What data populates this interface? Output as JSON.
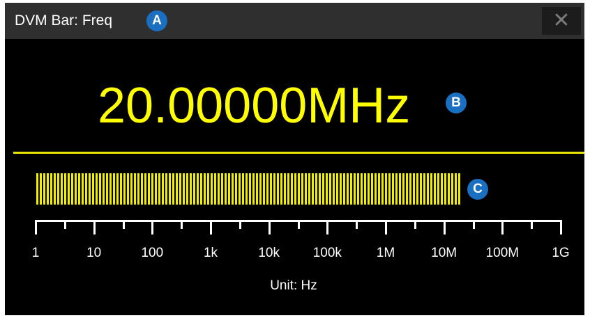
{
  "window": {
    "title": "DVM Bar: Freq",
    "close_symbol": "✕",
    "close_icon": "close-icon"
  },
  "callouts": {
    "a": "A",
    "b": "B",
    "c": "C"
  },
  "measurement": {
    "display_value": "20.00000MHz",
    "frequency_hz": 20000000
  },
  "bar": {
    "fill_percent": 82.1
  },
  "scale": {
    "ticks": [
      "1",
      "10",
      "100",
      "1k",
      "10k",
      "100k",
      "1M",
      "10M",
      "100M",
      "1G"
    ],
    "unit_label": "Unit: Hz"
  },
  "colors": {
    "reading": "#ffff00",
    "bar": "#f2ee00",
    "callout": "#1a6fc0",
    "titlebar": "#2f2f2f",
    "background": "#000000"
  }
}
